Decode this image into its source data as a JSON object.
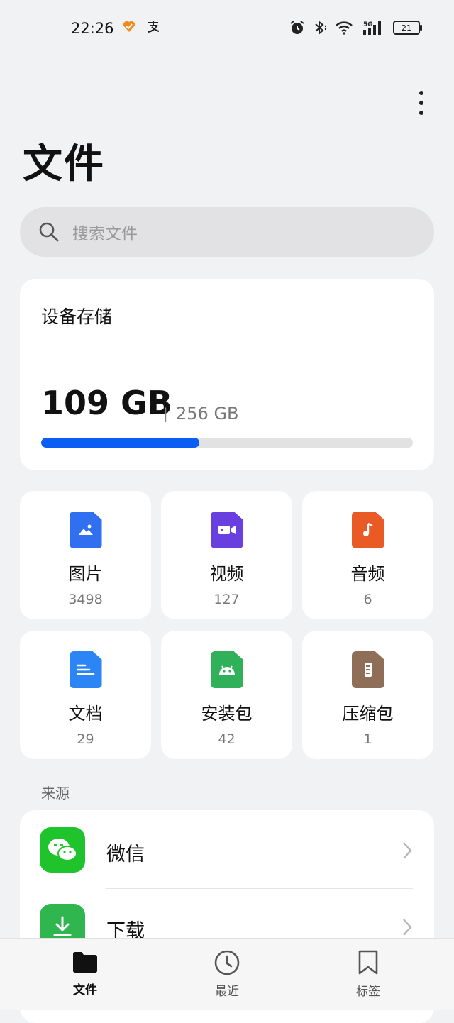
{
  "status_bar": {
    "time": "22:26",
    "app_icons": [
      "heart-app-icon",
      "alipay-icon"
    ],
    "right_icons": [
      "alarm-icon",
      "bluetooth-icon",
      "wifi-icon",
      "signal-5g-icon"
    ],
    "battery": "21"
  },
  "header": {
    "title": "文件",
    "more_icon": "more-vertical-icon"
  },
  "search": {
    "placeholder": "搜索文件"
  },
  "storage": {
    "title": "设备存储",
    "used": "109 GB",
    "separator": "|",
    "total": "256 GB",
    "used_fraction": 0.426,
    "bar_color": "#0a5ef3"
  },
  "categories": [
    {
      "label": "图片",
      "count": "3498",
      "icon": "image-file-icon",
      "color": "#2f6ff0"
    },
    {
      "label": "视频",
      "count": "127",
      "icon": "video-file-icon",
      "color": "#6a3fe0"
    },
    {
      "label": "音频",
      "count": "6",
      "icon": "audio-file-icon",
      "color": "#ea5a24"
    },
    {
      "label": "文档",
      "count": "29",
      "icon": "document-file-icon",
      "color": "#2c85f5"
    },
    {
      "label": "安装包",
      "count": "42",
      "icon": "apk-file-icon",
      "color": "#30b058"
    },
    {
      "label": "压缩包",
      "count": "1",
      "icon": "archive-file-icon",
      "color": "#8f6e58"
    }
  ],
  "sources": {
    "section_label": "来源",
    "items": [
      {
        "label": "微信",
        "icon": "wechat-icon",
        "color": "#1fc32c"
      },
      {
        "label": "下载",
        "icon": "download-icon",
        "color": "#2fb64f"
      }
    ]
  },
  "bottom_nav": [
    {
      "label": "文件",
      "icon": "folder-icon",
      "active": true
    },
    {
      "label": "最近",
      "icon": "clock-icon",
      "active": false
    },
    {
      "label": "标签",
      "icon": "bookmark-icon",
      "active": false
    }
  ]
}
